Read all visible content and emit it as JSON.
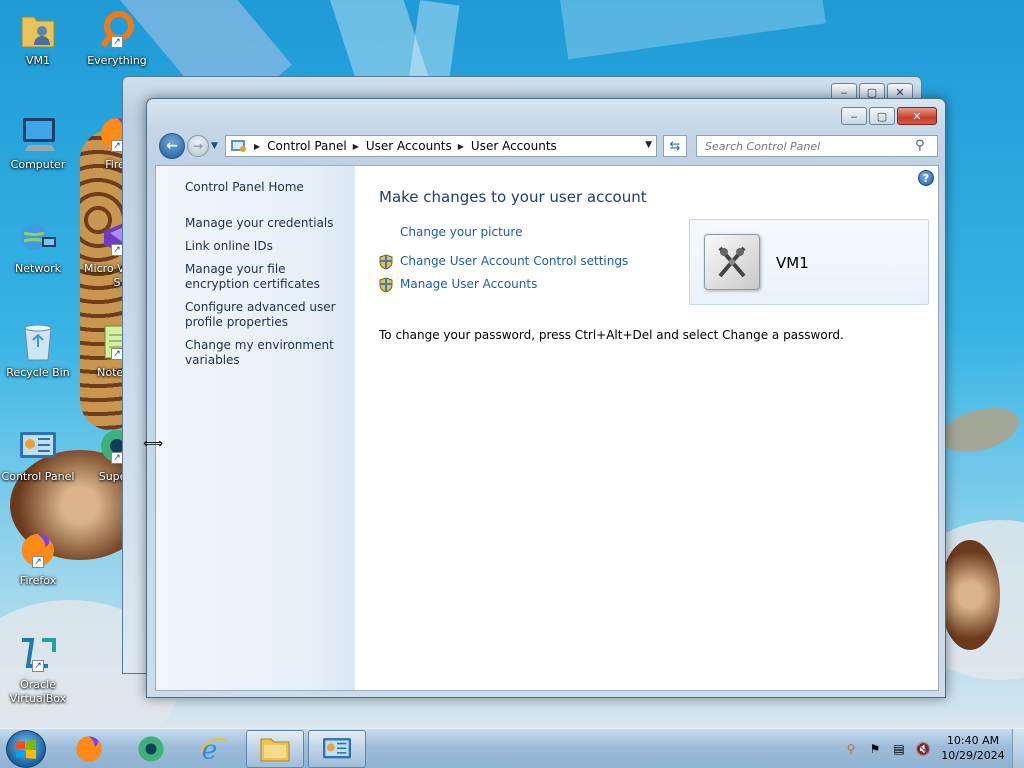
{
  "desktop": {
    "icons": [
      {
        "label": "VM1",
        "icon": "user-folder-icon"
      },
      {
        "label": "Everything",
        "icon": "everything-search-icon"
      },
      {
        "label": "Computer",
        "icon": "computer-icon"
      },
      {
        "label": "Firef",
        "icon": "firefox-icon"
      },
      {
        "label": "Network",
        "icon": "network-icon"
      },
      {
        "label": "Micro Visual S",
        "icon": "visual-studio-icon"
      },
      {
        "label": "Recycle Bin",
        "icon": "recycle-bin-icon"
      },
      {
        "label": "Notepa",
        "icon": "notepad-icon"
      },
      {
        "label": "Control Panel",
        "icon": "control-panel-icon"
      },
      {
        "label": "Superr",
        "icon": "supermium-icon"
      },
      {
        "label": "Firefox",
        "icon": "firefox-icon"
      },
      {
        "label": "Oracle VirtualBox",
        "icon": "virtualbox-icon"
      }
    ]
  },
  "window": {
    "address": {
      "crumbs": [
        "Control Panel",
        "User Accounts",
        "User Accounts"
      ]
    },
    "search": {
      "placeholder": "Search Control Panel"
    },
    "sidebar": {
      "home_link": "Control Panel Home",
      "links": [
        "Manage your credentials",
        "Link online IDs",
        "Manage your file encryption certificates",
        "Configure advanced user profile properties",
        "Change my environment variables"
      ]
    },
    "main": {
      "title": "Make changes to your user account",
      "tasks": [
        "Change your picture",
        "Change User Account Control settings",
        "Manage User Accounts"
      ],
      "password_note": "To change your password, press Ctrl+Alt+Del and select Change a password."
    },
    "account": {
      "name": "VM1"
    }
  },
  "taskbar": {
    "pinned": [
      "firefox-icon",
      "supermium-icon",
      "internet-explorer-icon",
      "file-explorer-icon",
      "control-panel-icon"
    ],
    "clock": {
      "time": "10:40 AM",
      "date": "10/29/2024"
    }
  },
  "colors": {
    "link": "#1e5aa8",
    "title": "#1e3a7a",
    "sidebar_bg": "#e6eff8",
    "desktop_bg": "#2aa7d8"
  }
}
